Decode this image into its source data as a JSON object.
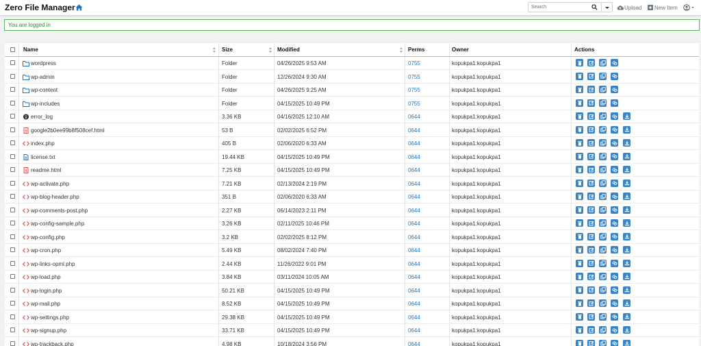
{
  "app": {
    "title": "Zero File Manager",
    "search_placeholder": "Search",
    "upload_label": "Upload",
    "new_item_label": "New Item",
    "alert": "You are logged in"
  },
  "table": {
    "headers": {
      "name": "Name",
      "size": "Size",
      "modified": "Modified",
      "perms": "Perms",
      "owner": "Owner",
      "actions": "Actions"
    },
    "rows": [
      {
        "icon": "folder",
        "name": "wordpress",
        "size": "Folder",
        "modified": "04/26/2025 9:53 AM",
        "perms": "0755",
        "owner": "kopukpa1:kopukpa1",
        "download": false
      },
      {
        "icon": "folder",
        "name": "wp-admin",
        "size": "Folder",
        "modified": "12/26/2024 9:30 AM",
        "perms": "0755",
        "owner": "kopukpa1:kopukpa1",
        "download": false
      },
      {
        "icon": "folder",
        "name": "wp-content",
        "size": "Folder",
        "modified": "04/26/2025 9:25 AM",
        "perms": "0755",
        "owner": "kopukpa1:kopukpa1",
        "download": false
      },
      {
        "icon": "folder",
        "name": "wp-includes",
        "size": "Folder",
        "modified": "04/15/2025 10:49 PM",
        "perms": "0755",
        "owner": "kopukpa1:kopukpa1",
        "download": false
      },
      {
        "icon": "info",
        "name": "error_log",
        "size": "3.36 KB",
        "modified": "04/16/2025 12:10 AM",
        "perms": "0644",
        "owner": "kopukpa1:kopukpa1",
        "download": true
      },
      {
        "icon": "html",
        "name": "google2b0ee99b8f508cef.html",
        "size": "53 B",
        "modified": "02/02/2025 6:52 PM",
        "perms": "0644",
        "owner": "kopukpa1:kopukpa1",
        "download": true
      },
      {
        "icon": "code",
        "name": "index.php",
        "size": "405 B",
        "modified": "02/06/2020 6:33 AM",
        "perms": "0644",
        "owner": "kopukpa1:kopukpa1",
        "download": true
      },
      {
        "icon": "text",
        "name": "license.txt",
        "size": "19.44 KB",
        "modified": "04/15/2025 10:49 PM",
        "perms": "0644",
        "owner": "kopukpa1:kopukpa1",
        "download": true
      },
      {
        "icon": "html",
        "name": "readme.html",
        "size": "7.25 KB",
        "modified": "04/15/2025 10:49 PM",
        "perms": "0644",
        "owner": "kopukpa1:kopukpa1",
        "download": true
      },
      {
        "icon": "code",
        "name": "wp-activate.php",
        "size": "7.21 KB",
        "modified": "02/13/2024 2:19 PM",
        "perms": "0644",
        "owner": "kopukpa1:kopukpa1",
        "download": true
      },
      {
        "icon": "code",
        "name": "wp-blog-header.php",
        "size": "351 B",
        "modified": "02/06/2020 6:33 AM",
        "perms": "0644",
        "owner": "kopukpa1:kopukpa1",
        "download": true
      },
      {
        "icon": "code",
        "name": "wp-comments-post.php",
        "size": "2.27 KB",
        "modified": "06/14/2023 2:11 PM",
        "perms": "0644",
        "owner": "kopukpa1:kopukpa1",
        "download": true
      },
      {
        "icon": "code",
        "name": "wp-config-sample.php",
        "size": "3.26 KB",
        "modified": "02/11/2025 10:46 PM",
        "perms": "0644",
        "owner": "kopukpa1:kopukpa1",
        "download": true
      },
      {
        "icon": "code",
        "name": "wp-config.php",
        "size": "3.2 KB",
        "modified": "02/02/2025 8:12 PM",
        "perms": "0644",
        "owner": "kopukpa1:kopukpa1",
        "download": true
      },
      {
        "icon": "code",
        "name": "wp-cron.php",
        "size": "5.49 KB",
        "modified": "08/02/2024 7:40 PM",
        "perms": "0644",
        "owner": "kopukpa1:kopukpa1",
        "download": true
      },
      {
        "icon": "code",
        "name": "wp-links-opml.php",
        "size": "2.44 KB",
        "modified": "11/26/2022 9:01 PM",
        "perms": "0644",
        "owner": "kopukpa1:kopukpa1",
        "download": true
      },
      {
        "icon": "code",
        "name": "wp-load.php",
        "size": "3.84 KB",
        "modified": "03/11/2024 10:05 AM",
        "perms": "0644",
        "owner": "kopukpa1:kopukpa1",
        "download": true
      },
      {
        "icon": "code",
        "name": "wp-login.php",
        "size": "50.21 KB",
        "modified": "04/15/2025 10:49 PM",
        "perms": "0644",
        "owner": "kopukpa1:kopukpa1",
        "download": true
      },
      {
        "icon": "code",
        "name": "wp-mail.php",
        "size": "8.52 KB",
        "modified": "04/15/2025 10:49 PM",
        "perms": "0644",
        "owner": "kopukpa1:kopukpa1",
        "download": true
      },
      {
        "icon": "code",
        "name": "wp-settings.php",
        "size": "29.38 KB",
        "modified": "04/15/2025 10:49 PM",
        "perms": "0644",
        "owner": "kopukpa1:kopukpa1",
        "download": true
      },
      {
        "icon": "code",
        "name": "wp-signup.php",
        "size": "33.71 KB",
        "modified": "04/15/2025 10:49 PM",
        "perms": "0644",
        "owner": "kopukpa1:kopukpa1",
        "download": true
      },
      {
        "icon": "code",
        "name": "wp-trackback.php",
        "size": "4.98 KB",
        "modified": "10/18/2024 3:56 PM",
        "perms": "0644",
        "owner": "kopukpa1:kopukpa1",
        "download": true
      }
    ]
  },
  "colors": {
    "accent": "#3b84c4",
    "folder_icon": "#1e73be",
    "code_icon": "#d9534f",
    "html_icon": "#d9534f",
    "alert_border": "#5cb85c",
    "alert_text": "#2d8a2d",
    "perm_link": "#1e73be"
  }
}
